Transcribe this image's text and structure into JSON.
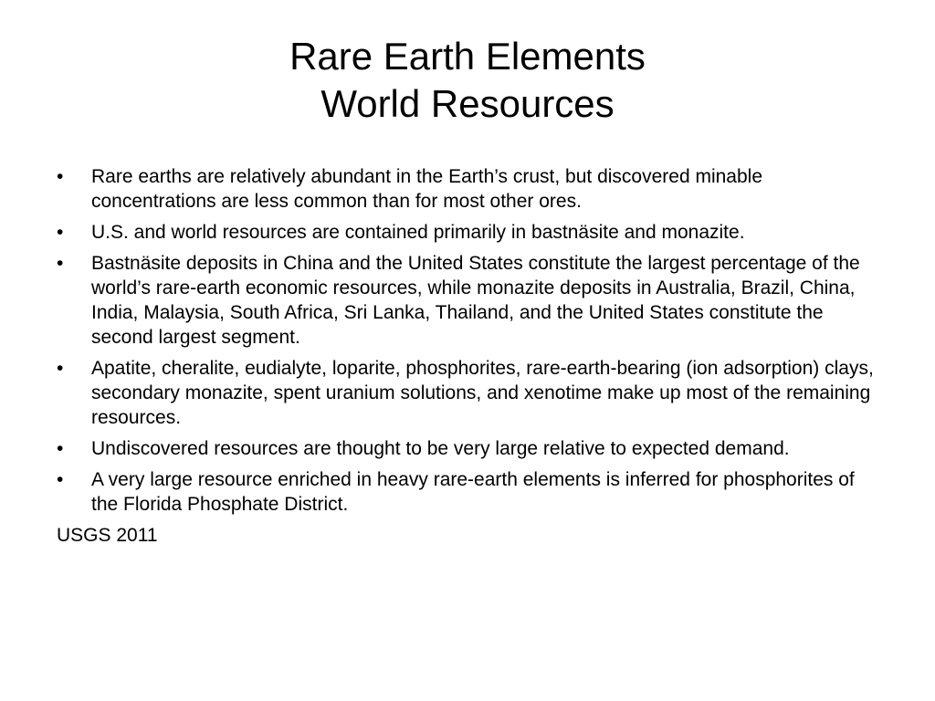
{
  "slide": {
    "title_line_1": "Rare Earth Elements",
    "title_line_2": "World Resources",
    "bullet_symbol": "•",
    "bullets": [
      {
        "text": "Rare earths are relatively abundant in the Earth’s crust, but discovered minable concentrations are less common than for most other ores."
      },
      {
        "text": "U.S. and world resources are contained primarily in bastnäsite and monazite."
      },
      {
        "text": "Bastnäsite deposits in China and the United States constitute the largest percentage of the world’s rare-earth economic resources, while monazite deposits in Australia, Brazil, China, India, Malaysia, South Africa, Sri Lanka, Thailand, and the United States constitute the second largest segment."
      },
      {
        "text": "Apatite, cheralite, eudialyte, loparite, phosphorites, rare-earth-bearing (ion adsorption) clays, secondary monazite, spent uranium solutions, and xenotime make up most of the remaining resources."
      },
      {
        "text": "Undiscovered resources are thought to be very large relative to expected demand."
      },
      {
        "text": "A very large resource enriched in heavy rare-earth elements is inferred for phosphorites of the Florida Phosphate District."
      }
    ],
    "source": "USGS 2011"
  }
}
